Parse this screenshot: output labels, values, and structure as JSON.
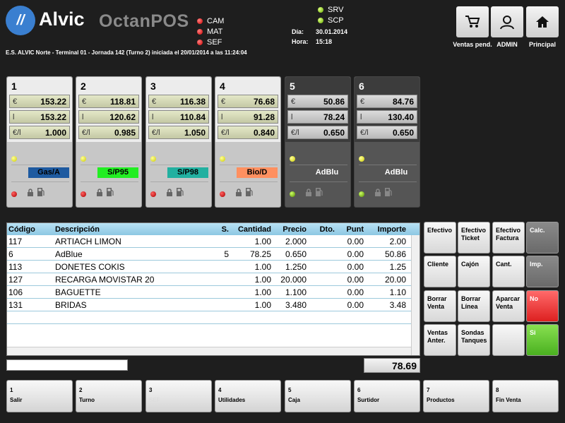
{
  "brand": {
    "logo_mark": "//",
    "name": "Alvic",
    "product": "OctanPOS"
  },
  "status_left": [
    {
      "label": "CAM",
      "color": "red"
    },
    {
      "label": "MAT",
      "color": "red"
    },
    {
      "label": "SEF",
      "color": "red"
    }
  ],
  "status_right": [
    {
      "label": "SRV",
      "color": "green"
    },
    {
      "label": "SCP",
      "color": "green"
    }
  ],
  "info": {
    "date_label": "Día:",
    "date": "30.01.2014",
    "time_label": "Hora:",
    "time": "15:18"
  },
  "top_buttons": {
    "pending": "Ventas pend.",
    "admin": "ADMIN",
    "home": "Principal"
  },
  "banner": "E.S. ALVIC Norte - Terminal 01 - Jornada 142 (Turno 2) iniciada el 20/01/2014 a las 11:24:04",
  "pumps": [
    {
      "num": "1",
      "euro": "153.22",
      "liters": "153.22",
      "price": "1.000",
      "fuel": "Gas/A",
      "color": "#1e5aa0",
      "active": true
    },
    {
      "num": "2",
      "euro": "118.81",
      "liters": "120.62",
      "price": "0.985",
      "fuel": "S/P95",
      "color": "#22ee22",
      "active": true
    },
    {
      "num": "3",
      "euro": "116.38",
      "liters": "110.84",
      "price": "1.050",
      "fuel": "S/P98",
      "color": "#22b0a0",
      "active": true
    },
    {
      "num": "4",
      "euro": "76.68",
      "liters": "91.28",
      "price": "0.840",
      "fuel": "Bio/D",
      "color": "#ff9060",
      "active": true
    },
    {
      "num": "5",
      "euro": "50.86",
      "liters": "78.24",
      "price": "0.650",
      "fuel": "AdBlu",
      "color": "#3c3c3c",
      "active": false
    },
    {
      "num": "6",
      "euro": "84.76",
      "liters": "130.40",
      "price": "0.650",
      "fuel": "AdBlu",
      "color": "#3c3c3c",
      "active": false
    }
  ],
  "pump_units": {
    "euro": "€",
    "liters": "l",
    "price": "€/l"
  },
  "table": {
    "headers": {
      "code": "Código",
      "desc": "Descripción",
      "s": "S.",
      "cant": "Cantidad",
      "prec": "Precio",
      "dto": "Dto.",
      "punt": "Punt",
      "imp": "Importe"
    },
    "rows": [
      {
        "code": "117",
        "desc": "ARTIACH LIMON",
        "s": "",
        "cant": "1.00",
        "prec": "2.000",
        "punt": "0.00",
        "imp": "2.00"
      },
      {
        "code": "6",
        "desc": "AdBlue",
        "s": "5",
        "cant": "78.25",
        "prec": "0.650",
        "punt": "0.00",
        "imp": "50.86"
      },
      {
        "code": "113",
        "desc": "DONETES COKIS",
        "s": "",
        "cant": "1.00",
        "prec": "1.250",
        "punt": "0.00",
        "imp": "1.25"
      },
      {
        "code": "127",
        "desc": "RECARGA MOVISTAR 20",
        "s": "",
        "cant": "1.00",
        "prec": "20.000",
        "punt": "0.00",
        "imp": "20.00"
      },
      {
        "code": "106",
        "desc": "BAGUETTE",
        "s": "",
        "cant": "1.00",
        "prec": "1.100",
        "punt": "0.00",
        "imp": "1.10"
      },
      {
        "code": "131",
        "desc": "BRIDAS",
        "s": "",
        "cant": "1.00",
        "prec": "3.480",
        "punt": "0.00",
        "imp": "3.48"
      }
    ]
  },
  "total": "78.69",
  "side_buttons": [
    {
      "label": "Efectivo",
      "style": "light"
    },
    {
      "label": "Efectivo Ticket",
      "style": "light"
    },
    {
      "label": "Efectivo Factura",
      "style": "light"
    },
    {
      "label": "Calc.",
      "style": "gray"
    },
    {
      "label": "Cliente",
      "style": "light"
    },
    {
      "label": "Cajón",
      "style": "light"
    },
    {
      "label": "Cant.",
      "style": "light"
    },
    {
      "label": "Imp.",
      "style": "gray"
    },
    {
      "label": "Borrar Venta",
      "style": "light"
    },
    {
      "label": "Borrar Línea",
      "style": "light"
    },
    {
      "label": "Aparcar Venta",
      "style": "light"
    },
    {
      "label": "No",
      "style": "red"
    },
    {
      "label": "Ventas Anter.",
      "style": "light"
    },
    {
      "label": "Sondas Tanques",
      "style": "light"
    },
    {
      "label": "",
      "style": "light"
    },
    {
      "label": "Si",
      "style": "green"
    }
  ],
  "footer": [
    {
      "num": "1",
      "label": "Salir",
      "disabled": false
    },
    {
      "num": "2",
      "label": "Turno",
      "disabled": false
    },
    {
      "num": "3",
      "label": "SEF",
      "disabled": true
    },
    {
      "num": "4",
      "label": "Utilidades",
      "disabled": false
    },
    {
      "num": "5",
      "label": "Caja",
      "disabled": false
    },
    {
      "num": "6",
      "label": "Surtidor",
      "disabled": false
    },
    {
      "num": "7",
      "label": "Productos",
      "disabled": false
    },
    {
      "num": "8",
      "label": "Fin Venta",
      "disabled": false
    }
  ]
}
